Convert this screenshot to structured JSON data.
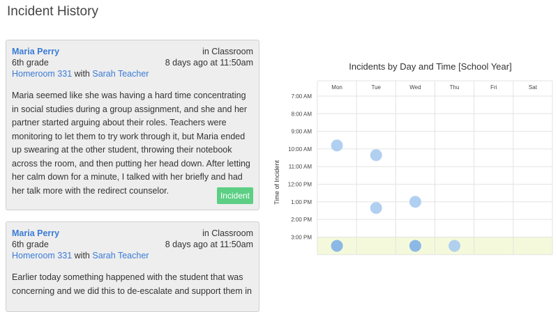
{
  "page": {
    "title": "Incident History"
  },
  "incidents": [
    {
      "student": "Maria Perry",
      "location": "in Classroom",
      "grade": "6th grade",
      "time_ago": "8 days ago at 11:50am",
      "homeroom": "Homeroom 331",
      "with_label": "with",
      "teacher": "Sarah Teacher",
      "text": "Maria seemed like she was having a hard time concentrating in social studies during a group assignment, and she and her partner started arguing about their roles. Teachers were monitoring to let them to try work through it, but Maria ended up swearing at the other student, throwing their notebook across the room, and then putting her head down. After letting her calm down for a minute, I talked with her briefly and had her talk more with the redirect counselor.",
      "badge": "Incident"
    },
    {
      "student": "Maria Perry",
      "location": "in Classroom",
      "grade": "6th grade",
      "time_ago": "8 days ago at 11:50am",
      "homeroom": "Homeroom 331",
      "with_label": "with",
      "teacher": "Sarah Teacher",
      "text": "Earlier today something happened with the student that was concerning and we did this to de-escalate and support them in"
    }
  ],
  "chart_data": {
    "type": "scatter",
    "title": "Incidents by Day and Time [School Year]",
    "ylabel": "Time of Incident",
    "categories": [
      "Mon",
      "Tue",
      "Wed",
      "Thu",
      "Fri",
      "Sat"
    ],
    "y_ticks": [
      "7:00 AM",
      "8:00 AM",
      "9:00 AM",
      "10:00 AM",
      "11:00 AM",
      "12:00 PM",
      "1:00 PM",
      "2:00 PM",
      "3:00 PM"
    ],
    "ylim": [
      7,
      16
    ],
    "highlight_band": [
      15,
      16
    ],
    "highlight_color": "#f5f9dc",
    "point_color": "#a9cbef",
    "point_color_dark": "#7fb0e6",
    "points": [
      {
        "day": "Mon",
        "hour": 9.8,
        "dark": false
      },
      {
        "day": "Tue",
        "hour": 10.35,
        "dark": false
      },
      {
        "day": "Tue",
        "hour": 13.35,
        "dark": false
      },
      {
        "day": "Wed",
        "hour": 13.0,
        "dark": false
      },
      {
        "day": "Mon",
        "hour": 15.5,
        "dark": true
      },
      {
        "day": "Wed",
        "hour": 15.5,
        "dark": true
      },
      {
        "day": "Thu",
        "hour": 15.5,
        "dark": false
      }
    ]
  }
}
